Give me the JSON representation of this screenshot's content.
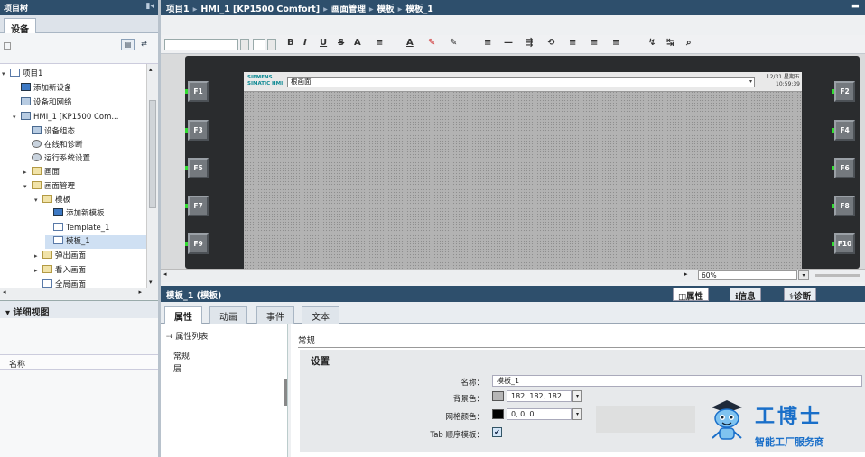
{
  "left_pane": {
    "title": "项目树",
    "tab": "设备",
    "tree": [
      {
        "label": "项目1",
        "depth": 0,
        "arrow": "▾",
        "icon": "page"
      },
      {
        "label": "添加新设备",
        "depth": 1,
        "arrow": "",
        "icon": "add"
      },
      {
        "label": "设备和网络",
        "depth": 1,
        "arrow": "",
        "icon": "dev"
      },
      {
        "label": "HMI_1 [KP1500 Com...",
        "depth": 1,
        "arrow": "▾",
        "icon": "dev"
      },
      {
        "label": "设备组态",
        "depth": 2,
        "arrow": "",
        "icon": "dev"
      },
      {
        "label": "在线和诊断",
        "depth": 2,
        "arrow": "",
        "icon": "gear"
      },
      {
        "label": "运行系统设置",
        "depth": 2,
        "arrow": "",
        "icon": "gear"
      },
      {
        "label": "画面",
        "depth": 2,
        "arrow": "▸",
        "icon": "folder"
      },
      {
        "label": "画面管理",
        "depth": 2,
        "arrow": "▾",
        "icon": "folder"
      },
      {
        "label": "模板",
        "depth": 3,
        "arrow": "▾",
        "icon": "folder"
      },
      {
        "label": "添加新模板",
        "depth": 4,
        "arrow": "",
        "icon": "add"
      },
      {
        "label": "Template_1",
        "depth": 4,
        "arrow": "",
        "icon": "page"
      },
      {
        "label": "模板_1",
        "depth": 4,
        "arrow": "",
        "icon": "page",
        "selected": true
      },
      {
        "label": "弹出画面",
        "depth": 3,
        "arrow": "▸",
        "icon": "folder"
      },
      {
        "label": "看入画面",
        "depth": 3,
        "arrow": "▸",
        "icon": "folder"
      },
      {
        "label": "全局画面",
        "depth": 3,
        "arrow": "",
        "icon": "page"
      }
    ],
    "detail_view": "详细视图",
    "name_column": "名称"
  },
  "breadcrumb": [
    "项目1",
    "HMI_1 [KP1500 Comfort]",
    "画面管理",
    "模板",
    "模板_1"
  ],
  "format_toolbar": {
    "buttons": [
      "B",
      "I",
      "U",
      "S",
      "A",
      "≡",
      "A",
      "≡",
      "—",
      "≡",
      "≡",
      "≡"
    ]
  },
  "hmi_panel": {
    "fkeys_left": [
      "F1",
      "F3",
      "F5",
      "F7",
      "F9"
    ],
    "fkeys_right": [
      "F2",
      "F4",
      "F6",
      "F8",
      "F10"
    ],
    "logo": "SIEMENS SIMATIC HMI",
    "screen_combo": "根画面",
    "clock": "12/31 星期五\n10:59:39"
  },
  "zoom": "60%",
  "inspector": {
    "title": "模板_1 (模板)",
    "right_tabs": [
      "属性",
      "信息",
      "诊断"
    ],
    "prop_tabs": [
      "属性",
      "动画",
      "事件",
      "文本"
    ],
    "nav_header": "属性列表",
    "nav_items": [
      "常规",
      "层"
    ],
    "section": "常规",
    "settings_title": "设置",
    "fields": {
      "name_label": "名称：",
      "name_value": "模板_1",
      "bg_label": "背景色：",
      "bg_value": "182, 182, 182",
      "bg_color": "#b6b6b6",
      "grid_label": "网格颜色：",
      "grid_value": "0, 0, 0",
      "grid_color": "#000000",
      "tab_label": "Tab 顺序模板：",
      "tab_checked": "✔"
    }
  },
  "watermark": {
    "title": "工博士",
    "subtitle": "智能工厂服务商"
  }
}
